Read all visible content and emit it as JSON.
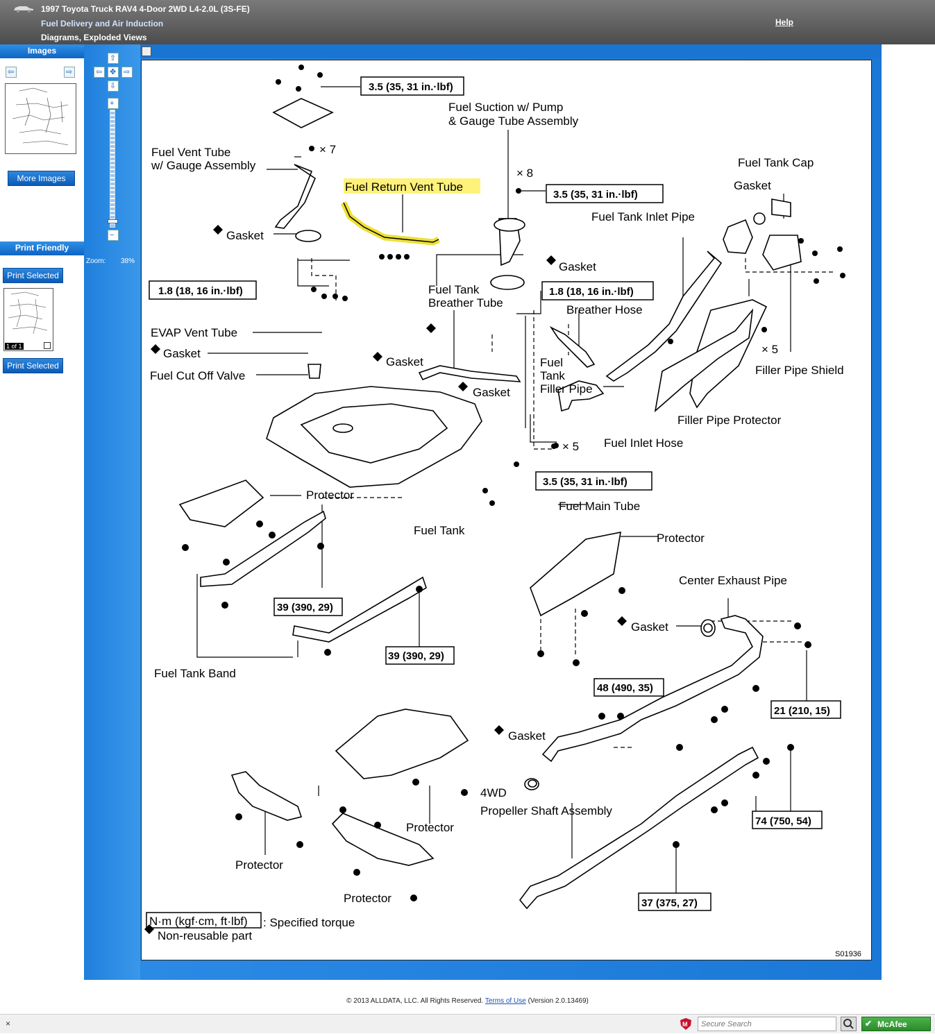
{
  "header": {
    "vehicle": "1997 Toyota Truck RAV4 4-Door 2WD L4-2.0L (3S-FE)",
    "section": "Fuel Delivery and Air Induction",
    "subsection": "Diagrams, Exploded Views",
    "help": "Help"
  },
  "left": {
    "images_title": "Images",
    "more_images": "More Images",
    "print_friendly": "Print Friendly",
    "print_selected_top": "Print Selected",
    "page_badge": "1 of 1",
    "print_selected_bottom": "Print Selected"
  },
  "zoom": {
    "label": "Zoom:",
    "value": "38%",
    "level_percent": 38
  },
  "diagram": {
    "labels": {
      "fuel_suction_1": "Fuel Suction w/ Pump",
      "fuel_suction_2": "& Gauge Tube Assembly",
      "fuel_vent_1": "Fuel Vent Tube",
      "fuel_vent_2": "w/ Gauge Assembly",
      "x7": "× 7",
      "x8": "× 8",
      "x5a": "× 5",
      "x5b": "× 5",
      "fuel_return": "Fuel Return Vent Tube",
      "fuel_tank_cap": "Fuel Tank Cap",
      "gasket_cap": "Gasket",
      "fuel_tank_inlet": "Fuel Tank Inlet Pipe",
      "gasket_1": "Gasket",
      "gasket_2": "Gasket",
      "fuel_tank_breather_1": "Fuel Tank",
      "fuel_tank_breather_2": "Breather Tube",
      "breather_hose": "Breather Hose",
      "evap": "EVAP Vent Tube",
      "gasket_3": "Gasket",
      "gasket_4": "Gasket",
      "fuel_cut": "Fuel Cut Off Valve",
      "fuel_filler_1": "Fuel",
      "fuel_filler_2": "Tank",
      "fuel_filler_3": "Filler Pipe",
      "gasket_5": "Gasket",
      "filler_shield": "Filler Pipe Shield",
      "filler_protector": "Filler Pipe Protector",
      "fuel_inlet_hose": "Fuel Inlet Hose",
      "protector_1": "Protector",
      "fuel_main_tube": "Fuel Main Tube",
      "fuel_tank": "Fuel Tank",
      "protector_2": "Protector",
      "center_exhaust": "Center Exhaust Pipe",
      "gasket_6": "Gasket",
      "fuel_tank_band": "Fuel Tank Band",
      "gasket_7": "Gasket",
      "prop_1": "4WD",
      "prop_2": "Propeller Shaft Assembly",
      "protector_3": "Protector",
      "protector_4": "Protector",
      "protector_5": "Protector",
      "legend_torque": "N·m (kgf·cm, ft·lbf)",
      "legend_torque_text": ": Specified torque",
      "legend_nonreuse": "Non-reusable part",
      "code": "S01936"
    },
    "torque": {
      "t1": "3.5 (35, 31 in.·lbf)",
      "t2": "3.5 (35, 31 in.·lbf)",
      "t3": "1.8 (18, 16 in.·lbf)",
      "t4": "1.8 (18, 16 in.·lbf)",
      "t5": "3.5 (35, 31 in.·lbf)",
      "t6": "39 (390, 29)",
      "t7": "39 (390, 29)",
      "t8": "48 (490, 35)",
      "t9": "21 (210, 15)",
      "t10": "74 (750, 54)",
      "t11": "37 (375, 27)"
    },
    "highlight_color": "#fff27a"
  },
  "footer": {
    "copyright": "© 2013 ALLDATA, LLC. All Rights Reserved.",
    "terms": "Terms of Use",
    "version": "(Version 2.0.13469)"
  },
  "statusbar": {
    "close": "×",
    "search_placeholder": "Secure Search",
    "mcafee": "McAfee"
  }
}
